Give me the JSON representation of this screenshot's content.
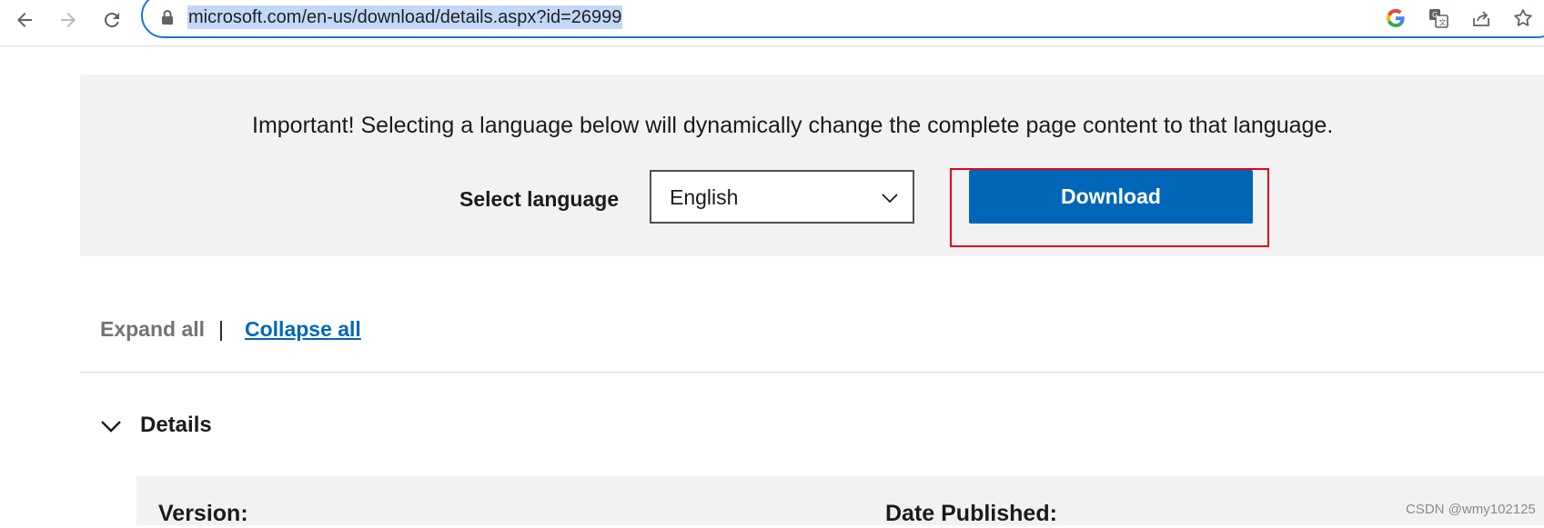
{
  "browser": {
    "url": "microsoft.com/en-us/download/details.aspx?id=26999",
    "icons": [
      "back-icon",
      "forward-icon",
      "reload-icon",
      "lock-icon",
      "google-icon",
      "translate-icon",
      "share-icon",
      "bookmark-star-icon"
    ]
  },
  "banner": {
    "notice": "Important! Selecting a language below will dynamically change the complete page content to that language.",
    "select_label": "Select language",
    "selected_language": "English",
    "download_label": "Download",
    "highlight_color": "#e60012",
    "button_color": "#0067b8"
  },
  "controls": {
    "expand_all": "Expand all",
    "separator": "|",
    "collapse_all": "Collapse all"
  },
  "details": {
    "heading": "Details",
    "version_label": "Version:",
    "date_published_label": "Date Published:"
  },
  "watermark": "CSDN @wmy102125"
}
